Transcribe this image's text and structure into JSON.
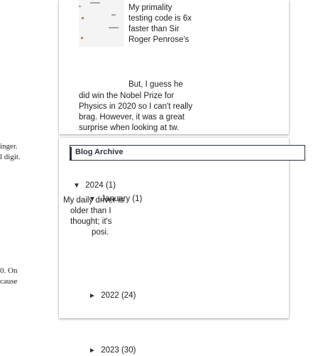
{
  "left_fragments": [
    "inger.",
    "l digit.",
    "0. On",
    "cause"
  ],
  "post": {
    "right_lines": [
      "My primality",
      "testing code is 6x",
      "faster than Sir",
      "Roger Penrose's",
      "But, I guess he"
    ],
    "body_lines": [
      "did win the Nobel Prize for",
      "Physics in 2020 so I can't really",
      "brag. However, it was a great",
      "surprise when looking at tw."
    ]
  },
  "archive": {
    "title": "Blog Archive",
    "year_2024": {
      "toggle": "▼",
      "label": "2024 (1)"
    },
    "month_january": {
      "toggle": "▼",
      "label": "January (1)"
    },
    "post_link": {
      "title_lines": [
        "My daily driver is",
        "older than I",
        "thought; it's",
        "posi."
      ]
    },
    "year_2023": {
      "toggle": "►",
      "label": "2023 (30)"
    },
    "year_2022": {
      "toggle": "►",
      "label": "2022 (24)"
    }
  }
}
